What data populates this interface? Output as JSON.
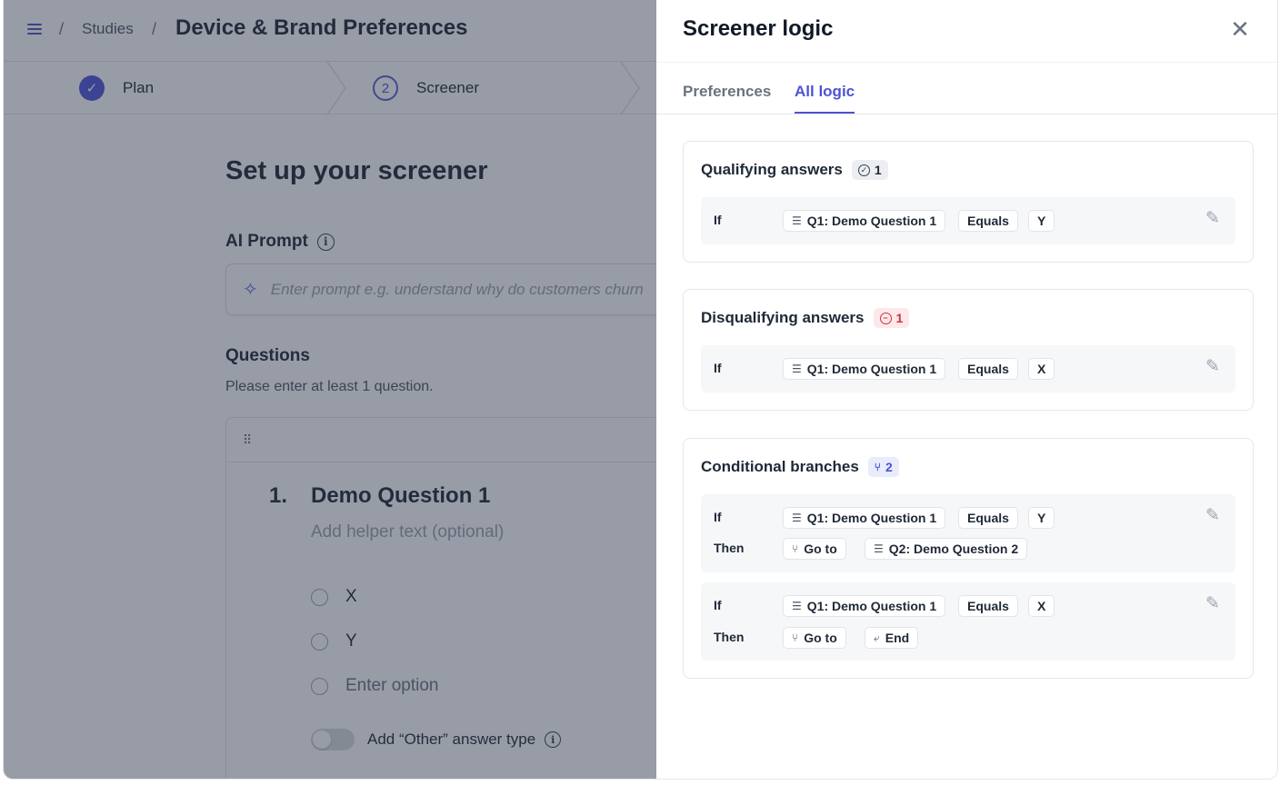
{
  "header": {
    "breadcrumb_studies": "Studies",
    "breadcrumb_sep": "/",
    "title": "Device & Brand Preferences"
  },
  "steps": [
    {
      "label": "Plan",
      "state": "done"
    },
    {
      "label": "Screener",
      "number": "2",
      "state": "current"
    }
  ],
  "setup": {
    "title": "Set up your screener",
    "ai_prompt_label": "AI Prompt",
    "prompt_placeholder": "Enter prompt e.g. understand why do customers churn",
    "questions_heading": "Questions",
    "questions_hint": "Please enter at least 1 question."
  },
  "question": {
    "number": "1.",
    "title": "Demo Question 1",
    "helper_placeholder": "Add helper text (optional)",
    "options": [
      "X",
      "Y"
    ],
    "new_option_placeholder": "Enter option",
    "other_label": "Add “Other” answer type"
  },
  "panel": {
    "title": "Screener logic",
    "tabs": [
      {
        "label": "Preferences",
        "active": false
      },
      {
        "label": "All logic",
        "active": true
      }
    ],
    "sections": {
      "qualifying": {
        "title": "Qualifying answers",
        "count": "1",
        "rule": {
          "if_label": "If",
          "question": "Q1: Demo Question 1",
          "operator": "Equals",
          "value": "Y"
        }
      },
      "disqualifying": {
        "title": "Disqualifying answers",
        "count": "1",
        "rule": {
          "if_label": "If",
          "question": "Q1: Demo Question 1",
          "operator": "Equals",
          "value": "X"
        }
      },
      "conditional": {
        "title": "Conditional branches",
        "count": "2",
        "rules": [
          {
            "if_label": "If",
            "question": "Q1: Demo Question 1",
            "operator": "Equals",
            "value": "Y",
            "then_label": "Then",
            "action": "Go to",
            "target": "Q2: Demo Question 2"
          },
          {
            "if_label": "If",
            "question": "Q1: Demo Question 1",
            "operator": "Equals",
            "value": "X",
            "then_label": "Then",
            "action": "Go to",
            "target": "End"
          }
        ]
      }
    }
  },
  "colors": {
    "accent": "#4e52d4",
    "danger": "#d0303e",
    "overlay": "#283046"
  }
}
